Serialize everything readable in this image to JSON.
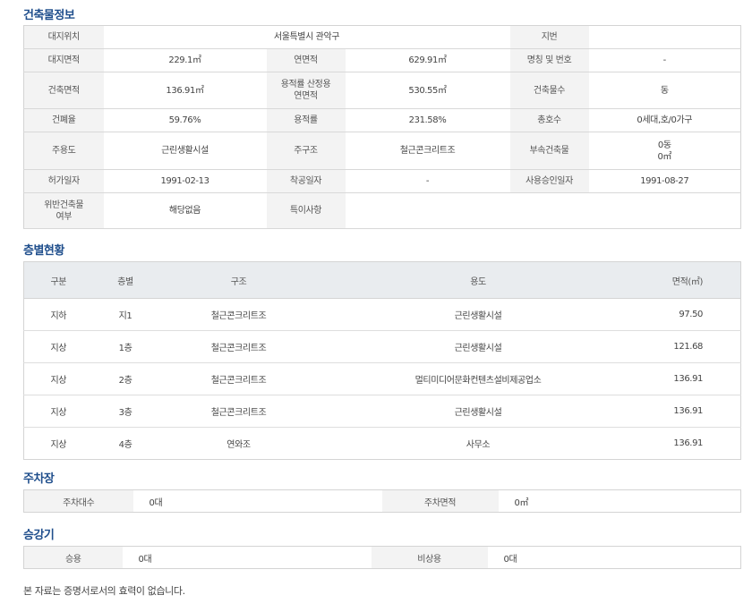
{
  "sections": {
    "building": "건축물정보",
    "floors": "층별현황",
    "parking": "주차장",
    "elevator": "승강기"
  },
  "building": {
    "site_location_label": "대지위치",
    "site_location": "서울특별시 관악구",
    "lot_label": "지번",
    "lot": "",
    "site_area_label": "대지면적",
    "site_area": "229.1㎡",
    "total_floor_area_label": "연면적",
    "total_floor_area": "629.91㎡",
    "name_label": "명칭 및 번호",
    "name": "-",
    "building_area_label": "건축면적",
    "building_area": "136.91㎡",
    "far_area_label_1": "용적률 산정용",
    "far_area_label_2": "연면적",
    "far_area": "530.55㎡",
    "building_count_label": "건축물수",
    "building_count": "동",
    "bcr_label": "건폐율",
    "bcr": "59.76%",
    "far_label": "용적률",
    "far": "231.58%",
    "households_label": "총호수",
    "households": "0세대,호/0가구",
    "main_use_label": "주용도",
    "main_use": "근린생활시설",
    "structure_label": "주구조",
    "structure": "철근콘크리트조",
    "annex_label": "부속건축물",
    "annex_count": "0동",
    "annex_area": "0㎡",
    "permit_date_label": "허가일자",
    "permit_date": "1991-02-13",
    "start_date_label": "착공일자",
    "start_date": "-",
    "approval_date_label": "사용승인일자",
    "approval_date": "1991-08-27",
    "violation_label_1": "위반건축물",
    "violation_label_2": "여부",
    "violation": "해당없음",
    "remarks_label": "특이사항",
    "remarks": ""
  },
  "floors": {
    "headers": [
      "구분",
      "층별",
      "구조",
      "용도",
      "면적(㎡)"
    ],
    "rows": [
      [
        "지하",
        "지1",
        "철근콘크리트조",
        "근린생활시설",
        "97.50"
      ],
      [
        "지상",
        "1층",
        "철근콘크리트조",
        "근린생활시설",
        "121.68"
      ],
      [
        "지상",
        "2층",
        "철근콘크리트조",
        "멀티미디어문화컨텐츠설비제공업소",
        "136.91"
      ],
      [
        "지상",
        "3층",
        "철근콘크리트조",
        "근린생활시설",
        "136.91"
      ],
      [
        "지상",
        "4층",
        "연와조",
        "사무소",
        "136.91"
      ]
    ]
  },
  "parking": {
    "count_label": "주차대수",
    "count": "0대",
    "area_label": "주차면적",
    "area": "0㎡"
  },
  "elevator": {
    "passenger_label": "승용",
    "passenger": "0대",
    "emergency_label": "비상용",
    "emergency": "0대"
  },
  "footnote": "본 자료는 증명서로서의 효력이 없습니다.",
  "colors": {
    "title": "#1f4e8c",
    "label_bg": "#f3f3f3",
    "header_bg": "#e9ecef",
    "border": "#d4d4d4"
  }
}
